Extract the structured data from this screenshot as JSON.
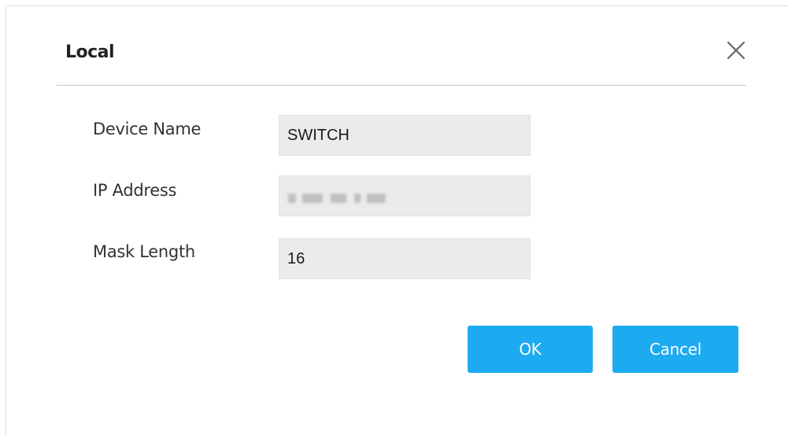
{
  "dialog": {
    "title": "Local",
    "close_icon": "close-icon"
  },
  "form": {
    "device_name": {
      "label": "Device Name",
      "value": "SWITCH"
    },
    "ip_address": {
      "label": "IP Address",
      "value": "",
      "obscured": true
    },
    "mask_length": {
      "label": "Mask Length",
      "value": "16"
    }
  },
  "buttons": {
    "ok_label": "OK",
    "cancel_label": "Cancel"
  },
  "colors": {
    "accent": "#1caaf0",
    "input_bg": "#ebebeb",
    "divider": "#c8c8c8"
  }
}
